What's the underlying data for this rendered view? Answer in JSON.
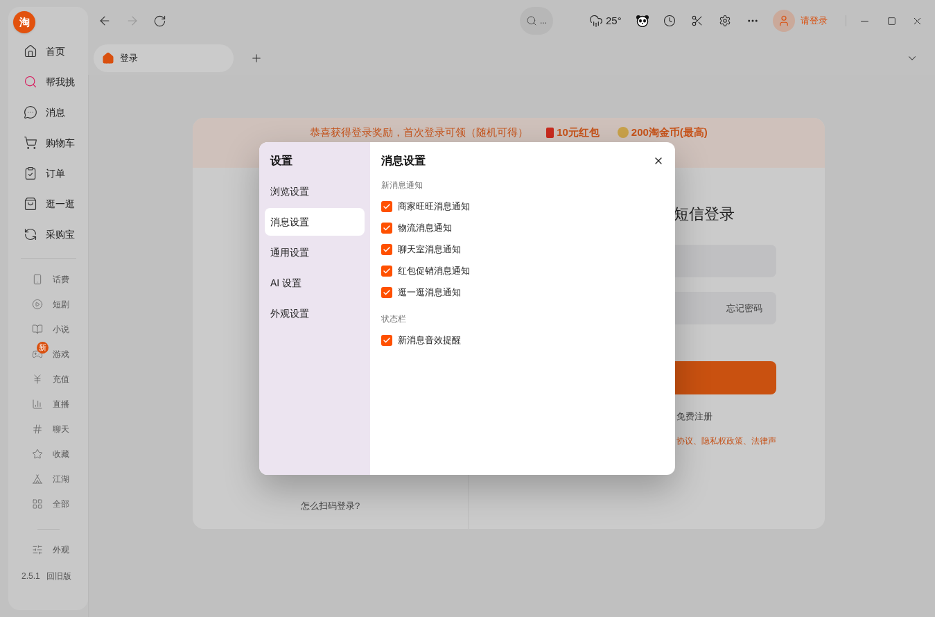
{
  "app": {
    "logo": "淘"
  },
  "sidebar": {
    "main_items": [
      {
        "label": "首页"
      },
      {
        "label": "帮我挑"
      },
      {
        "label": "消息"
      },
      {
        "label": "购物车"
      },
      {
        "label": "订单"
      },
      {
        "label": "逛一逛"
      },
      {
        "label": "采购宝"
      }
    ],
    "secondary_items": [
      {
        "label": "话费"
      },
      {
        "label": "短剧"
      },
      {
        "label": "小说"
      },
      {
        "label": "游戏",
        "badge": "新"
      },
      {
        "label": "充值"
      },
      {
        "label": "直播"
      },
      {
        "label": "聊天"
      },
      {
        "label": "收藏"
      },
      {
        "label": "江湖"
      },
      {
        "label": "全部"
      }
    ],
    "appearance": "外观",
    "version": "2.5.1",
    "legacy": "回旧版"
  },
  "toolbar": {
    "search_placeholder": "...",
    "weather": "25°",
    "user": "请登录"
  },
  "tabs": [
    {
      "label": "登录"
    }
  ],
  "login_page": {
    "banner": "恭喜获得登录奖励，首次登录可领（随机可得）",
    "reward_1": "10元红包",
    "reward_2": "200淘金币(最高)",
    "qr_help": "怎么扫码登录?",
    "title": "短信登录",
    "forgot": "忘记密码",
    "register": "免费注册",
    "agreement": "协议、隐私权政策、法律声"
  },
  "settings_dialog": {
    "title": "设置",
    "nav": [
      {
        "label": "浏览设置",
        "selected": false
      },
      {
        "label": "消息设置",
        "selected": true
      },
      {
        "label": "通用设置",
        "selected": false
      },
      {
        "label": "AI 设置",
        "selected": false
      },
      {
        "label": "外观设置",
        "selected": false
      }
    ],
    "section_title": "消息设置",
    "groups": [
      {
        "title": "新消息通知",
        "options": [
          {
            "label": "商家旺旺消息通知",
            "checked": true
          },
          {
            "label": "物流消息通知",
            "checked": true
          },
          {
            "label": "聊天室消息通知",
            "checked": true
          },
          {
            "label": "红包促销消息通知",
            "checked": true
          },
          {
            "label": "逛一逛消息通知",
            "checked": true
          }
        ]
      },
      {
        "title": "状态栏",
        "options": [
          {
            "label": "新消息音效提醒",
            "checked": true
          }
        ]
      }
    ]
  }
}
